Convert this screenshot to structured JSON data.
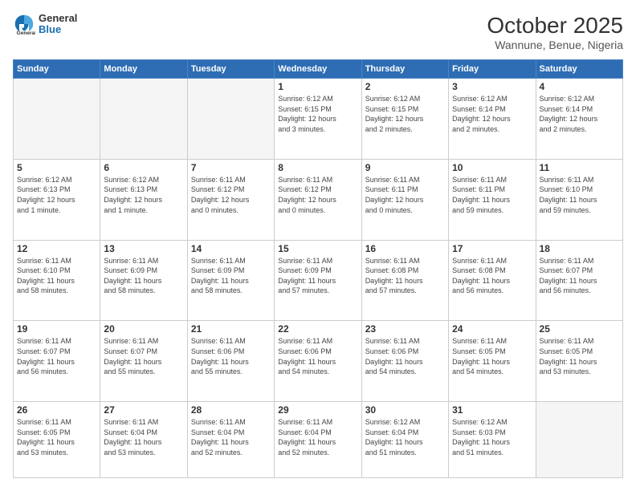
{
  "header": {
    "logo": {
      "general": "General",
      "blue": "Blue"
    },
    "title": "October 2025",
    "location": "Wannune, Benue, Nigeria"
  },
  "weekdays": [
    "Sunday",
    "Monday",
    "Tuesday",
    "Wednesday",
    "Thursday",
    "Friday",
    "Saturday"
  ],
  "rows": [
    [
      {
        "day": "",
        "info": ""
      },
      {
        "day": "",
        "info": ""
      },
      {
        "day": "",
        "info": ""
      },
      {
        "day": "1",
        "info": "Sunrise: 6:12 AM\nSunset: 6:15 PM\nDaylight: 12 hours\nand 3 minutes."
      },
      {
        "day": "2",
        "info": "Sunrise: 6:12 AM\nSunset: 6:15 PM\nDaylight: 12 hours\nand 2 minutes."
      },
      {
        "day": "3",
        "info": "Sunrise: 6:12 AM\nSunset: 6:14 PM\nDaylight: 12 hours\nand 2 minutes."
      },
      {
        "day": "4",
        "info": "Sunrise: 6:12 AM\nSunset: 6:14 PM\nDaylight: 12 hours\nand 2 minutes."
      }
    ],
    [
      {
        "day": "5",
        "info": "Sunrise: 6:12 AM\nSunset: 6:13 PM\nDaylight: 12 hours\nand 1 minute."
      },
      {
        "day": "6",
        "info": "Sunrise: 6:12 AM\nSunset: 6:13 PM\nDaylight: 12 hours\nand 1 minute."
      },
      {
        "day": "7",
        "info": "Sunrise: 6:11 AM\nSunset: 6:12 PM\nDaylight: 12 hours\nand 0 minutes."
      },
      {
        "day": "8",
        "info": "Sunrise: 6:11 AM\nSunset: 6:12 PM\nDaylight: 12 hours\nand 0 minutes."
      },
      {
        "day": "9",
        "info": "Sunrise: 6:11 AM\nSunset: 6:11 PM\nDaylight: 12 hours\nand 0 minutes."
      },
      {
        "day": "10",
        "info": "Sunrise: 6:11 AM\nSunset: 6:11 PM\nDaylight: 11 hours\nand 59 minutes."
      },
      {
        "day": "11",
        "info": "Sunrise: 6:11 AM\nSunset: 6:10 PM\nDaylight: 11 hours\nand 59 minutes."
      }
    ],
    [
      {
        "day": "12",
        "info": "Sunrise: 6:11 AM\nSunset: 6:10 PM\nDaylight: 11 hours\nand 58 minutes."
      },
      {
        "day": "13",
        "info": "Sunrise: 6:11 AM\nSunset: 6:09 PM\nDaylight: 11 hours\nand 58 minutes."
      },
      {
        "day": "14",
        "info": "Sunrise: 6:11 AM\nSunset: 6:09 PM\nDaylight: 11 hours\nand 58 minutes."
      },
      {
        "day": "15",
        "info": "Sunrise: 6:11 AM\nSunset: 6:09 PM\nDaylight: 11 hours\nand 57 minutes."
      },
      {
        "day": "16",
        "info": "Sunrise: 6:11 AM\nSunset: 6:08 PM\nDaylight: 11 hours\nand 57 minutes."
      },
      {
        "day": "17",
        "info": "Sunrise: 6:11 AM\nSunset: 6:08 PM\nDaylight: 11 hours\nand 56 minutes."
      },
      {
        "day": "18",
        "info": "Sunrise: 6:11 AM\nSunset: 6:07 PM\nDaylight: 11 hours\nand 56 minutes."
      }
    ],
    [
      {
        "day": "19",
        "info": "Sunrise: 6:11 AM\nSunset: 6:07 PM\nDaylight: 11 hours\nand 56 minutes."
      },
      {
        "day": "20",
        "info": "Sunrise: 6:11 AM\nSunset: 6:07 PM\nDaylight: 11 hours\nand 55 minutes."
      },
      {
        "day": "21",
        "info": "Sunrise: 6:11 AM\nSunset: 6:06 PM\nDaylight: 11 hours\nand 55 minutes."
      },
      {
        "day": "22",
        "info": "Sunrise: 6:11 AM\nSunset: 6:06 PM\nDaylight: 11 hours\nand 54 minutes."
      },
      {
        "day": "23",
        "info": "Sunrise: 6:11 AM\nSunset: 6:06 PM\nDaylight: 11 hours\nand 54 minutes."
      },
      {
        "day": "24",
        "info": "Sunrise: 6:11 AM\nSunset: 6:05 PM\nDaylight: 11 hours\nand 54 minutes."
      },
      {
        "day": "25",
        "info": "Sunrise: 6:11 AM\nSunset: 6:05 PM\nDaylight: 11 hours\nand 53 minutes."
      }
    ],
    [
      {
        "day": "26",
        "info": "Sunrise: 6:11 AM\nSunset: 6:05 PM\nDaylight: 11 hours\nand 53 minutes."
      },
      {
        "day": "27",
        "info": "Sunrise: 6:11 AM\nSunset: 6:04 PM\nDaylight: 11 hours\nand 53 minutes."
      },
      {
        "day": "28",
        "info": "Sunrise: 6:11 AM\nSunset: 6:04 PM\nDaylight: 11 hours\nand 52 minutes."
      },
      {
        "day": "29",
        "info": "Sunrise: 6:11 AM\nSunset: 6:04 PM\nDaylight: 11 hours\nand 52 minutes."
      },
      {
        "day": "30",
        "info": "Sunrise: 6:12 AM\nSunset: 6:04 PM\nDaylight: 11 hours\nand 51 minutes."
      },
      {
        "day": "31",
        "info": "Sunrise: 6:12 AM\nSunset: 6:03 PM\nDaylight: 11 hours\nand 51 minutes."
      },
      {
        "day": "",
        "info": ""
      }
    ]
  ]
}
